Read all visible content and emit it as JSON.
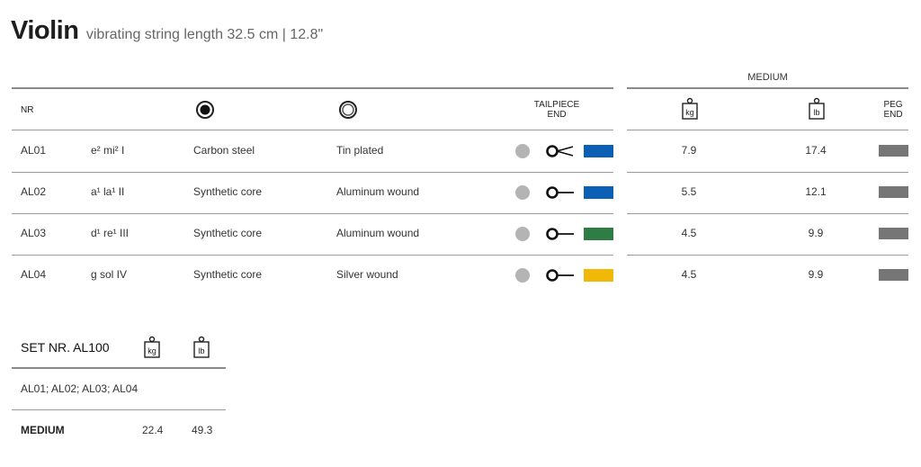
{
  "title": {
    "main": "Violin",
    "sub": "vibrating string length 32.5 cm | 12.8\""
  },
  "table": {
    "medium_label": "MEDIUM",
    "headers": {
      "nr": "NR",
      "tailpiece_end": [
        "TAILPIECE",
        "END"
      ],
      "peg_end": [
        "PEG",
        "END"
      ],
      "kg": "kg",
      "lb": "lb"
    },
    "rows": [
      {
        "nr": "AL01",
        "note": "e²  mi²  I",
        "core": "Carbon steel",
        "winding": "Tin plated",
        "end": "loop",
        "color": "#0b5fb4",
        "kg": "7.9",
        "lb": "17.4",
        "peg_color": "#767676"
      },
      {
        "nr": "AL02",
        "note": "a¹  la¹  II",
        "core": "Synthetic core",
        "winding": "Aluminum wound",
        "end": "ball",
        "color": "#0b5fb4",
        "kg": "5.5",
        "lb": "12.1",
        "peg_color": "#767676"
      },
      {
        "nr": "AL03",
        "note": "d¹  re¹  III",
        "core": "Synthetic core",
        "winding": "Aluminum wound",
        "end": "ball",
        "color": "#2e7d45",
        "kg": "4.5",
        "lb": "9.9",
        "peg_color": "#767676"
      },
      {
        "nr": "AL04",
        "note": "g  sol  IV",
        "core": "Synthetic core",
        "winding": "Silver wound",
        "end": "ball",
        "color": "#f1b807",
        "kg": "4.5",
        "lb": "9.9",
        "peg_color": "#767676"
      }
    ],
    "dot_color": "#b4b4b4"
  },
  "set": {
    "title": "SET NR. AL100",
    "kg": "kg",
    "lb": "lb",
    "contents": "AL01; AL02; AL03; AL04",
    "tension_label": "MEDIUM",
    "kg_value": "22.4",
    "lb_value": "49.3"
  }
}
